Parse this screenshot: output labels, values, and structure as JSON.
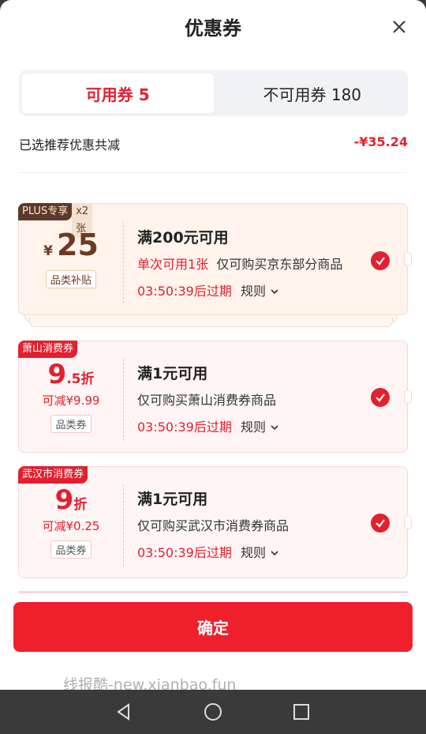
{
  "sheet": {
    "title": "优惠券"
  },
  "tabs": [
    {
      "label": "可用券 5",
      "active": true
    },
    {
      "label": "不可用券 180",
      "active": false
    }
  ],
  "summary": {
    "label": "已选推荐优惠共减",
    "amount": "-¥35.24"
  },
  "coupons": [
    {
      "badge": "PLUS专享",
      "badge_count": "x2张",
      "currency": "¥",
      "value": "25",
      "tag": "品类补贴",
      "condition": "满200元可用",
      "limit": "单次可用1张",
      "scope": "仅可购买京东部分商品",
      "expiry": "03:50:39后过期",
      "rule": "规则"
    },
    {
      "badge": "萧山消费券",
      "discount_big": "9",
      "discount_small": ".5折",
      "max_off": "可减¥9.99",
      "tag": "品类券",
      "condition": "满1元可用",
      "scope": "仅可购买萧山消费券商品",
      "expiry": "03:50:39后过期",
      "rule": "规则"
    },
    {
      "badge": "武汉市消费券",
      "discount_big": "9",
      "discount_small": "折",
      "max_off": "可减¥0.25",
      "tag": "品类券",
      "condition": "满1元可用",
      "scope": "仅可购买武汉市消费券商品",
      "expiry": "03:50:39后过期",
      "rule": "规则"
    }
  ],
  "confirm_label": "确定",
  "watermark": "线报酷-new.xianbao.fun",
  "colors": {
    "accent": "#e3202e",
    "confirm": "#ef1f2c",
    "plus_badge": "#5b3a2b"
  },
  "icons": [
    "close-icon",
    "check-circle-icon",
    "chevron-down-icon",
    "back-nav-icon",
    "home-nav-icon",
    "recents-nav-icon"
  ]
}
